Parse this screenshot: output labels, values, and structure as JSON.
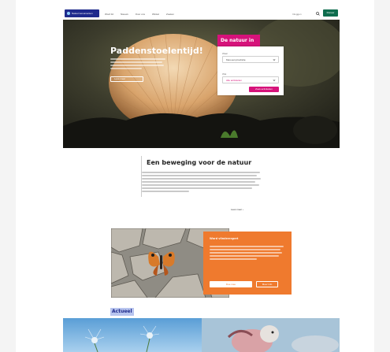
{
  "header": {
    "logo_text": "Natuurmonumenten",
    "nav_items": [
      "Word lid",
      "Nieuws",
      "Over ons",
      "Winkel",
      "Zoeken"
    ],
    "login": "Inloggen",
    "cta": "Doneer"
  },
  "hero": {
    "title": "Paddenstoelentijd!",
    "button": "Lees meer"
  },
  "form": {
    "title": "De natuur in",
    "field1_label": "Waar",
    "field1_value": "Kies een provincie",
    "field2_label": "Wat",
    "field2_value": "Alle activiteiten",
    "submit": "Zoek activiteiten"
  },
  "movement": {
    "title": "Een beweging voor de natuur",
    "read_more": "Lees meer"
  },
  "promo": {
    "title": "Word vlinderexpert",
    "primary_button": "Doe mee",
    "secondary_button": "Meer info"
  },
  "news": {
    "heading": "Actueel"
  },
  "colors": {
    "brand_blue": "#1f2a8c",
    "donate_green": "#0f6d4e",
    "accent_pink": "#d6127a",
    "promo_orange": "#ef7a2e"
  }
}
